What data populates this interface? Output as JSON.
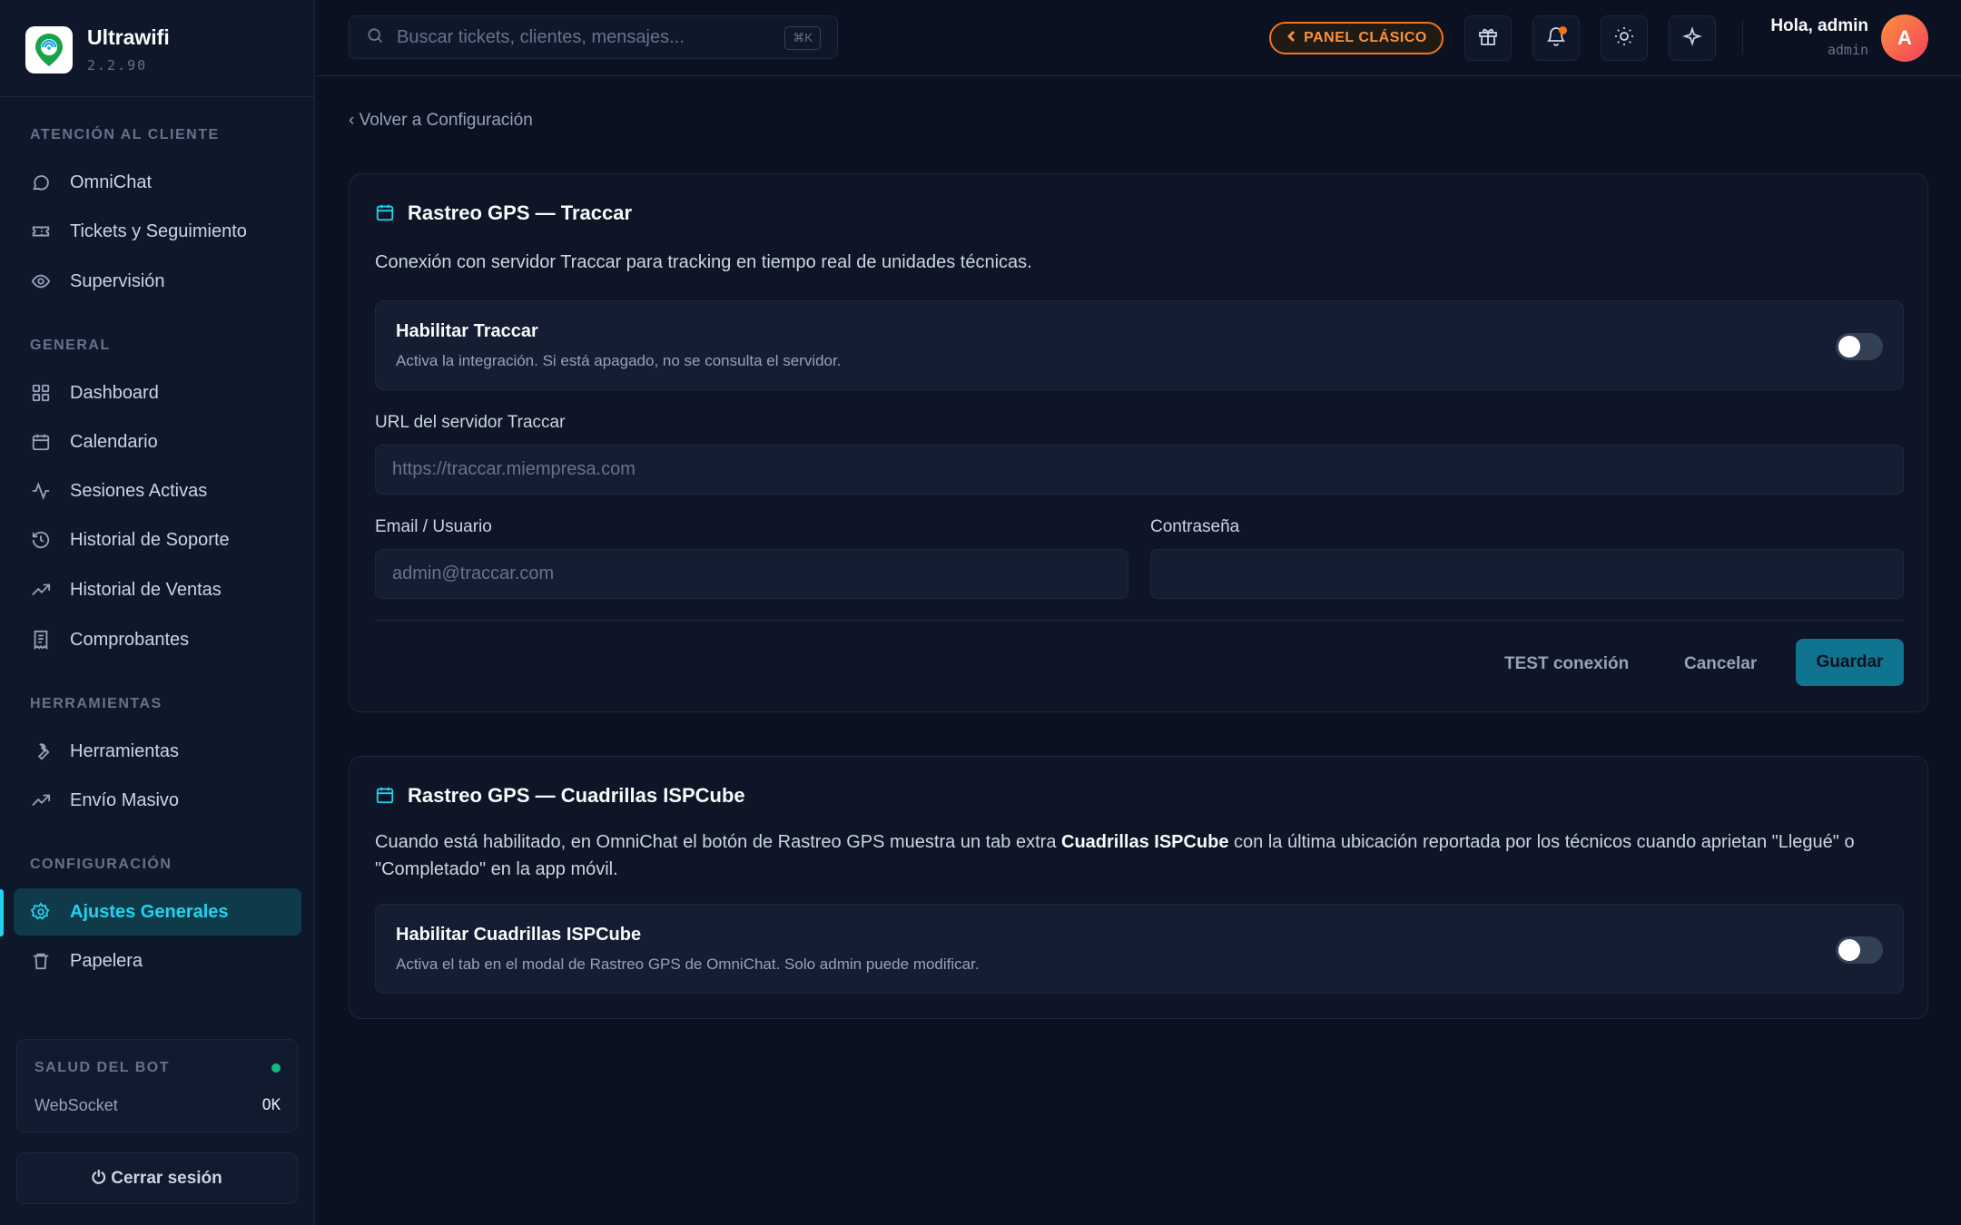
{
  "brand": {
    "name": "Ultrawifi",
    "version": "2.2.90"
  },
  "sidebar": {
    "sections": [
      {
        "title": "ATENCIÓN AL CLIENTE",
        "items": [
          "OmniChat",
          "Tickets y Seguimiento",
          "Supervisión"
        ]
      },
      {
        "title": "GENERAL",
        "items": [
          "Dashboard",
          "Calendario",
          "Sesiones Activas",
          "Historial de Soporte",
          "Historial de Ventas",
          "Comprobantes"
        ]
      },
      {
        "title": "HERRAMIENTAS",
        "items": [
          "Herramientas",
          "Envío Masivo"
        ]
      },
      {
        "title": "CONFIGURACIÓN",
        "items": [
          "Ajustes Generales",
          "Papelera"
        ]
      }
    ],
    "active_item": "Ajustes Generales",
    "bot_health": {
      "title": "SALUD DEL BOT",
      "label": "WebSocket",
      "value": "OK",
      "status_color": "#10b981"
    },
    "logout_label": "Cerrar sesión"
  },
  "header": {
    "search_placeholder": "Buscar tickets, clientes, mensajes...",
    "search_shortcut": "⌘K",
    "classic_panel_label": "PANEL CLÁSICO",
    "icons": [
      "gift-icon",
      "bell-icon",
      "sun-icon",
      "sparkle-icon"
    ],
    "greeting": "Hola, admin",
    "role": "admin",
    "avatar_initial": "A"
  },
  "main": {
    "back_link": "‹ Volver a Configuración",
    "traccar": {
      "title": "Rastreo GPS — Traccar",
      "description": "Conexión con servidor Traccar para tracking en tiempo real de unidades técnicas.",
      "toggle": {
        "title": "Habilitar Traccar",
        "subtitle": "Activa la integración. Si está apagado, no se consulta el servidor.",
        "enabled": false
      },
      "url_label": "URL del servidor Traccar",
      "url_placeholder": "https://traccar.miempresa.com",
      "email_label": "Email / Usuario",
      "email_placeholder": "admin@traccar.com",
      "password_label": "Contraseña",
      "test_label": "TEST conexión",
      "cancel_label": "Cancelar",
      "save_label": "Guardar"
    },
    "ispcube": {
      "title": "Rastreo GPS — Cuadrillas ISPCube",
      "description_pre": "Cuando está habilitado, en OmniChat el botón de Rastreo GPS muestra un tab extra ",
      "description_bold": "Cuadrillas ISPCube",
      "description_post": " con la última ubicación reportada por los técnicos cuando aprietan \"Llegué\" o \"Completado\" en la app móvil.",
      "toggle": {
        "title": "Habilitar Cuadrillas ISPCube",
        "subtitle": "Activa el tab en el modal de Rastreo GPS de OmniChat. Solo admin puede modificar.",
        "enabled": false
      }
    }
  },
  "colors": {
    "accent": "#22d3ee",
    "classic": "#f97316",
    "save": "#0e7490"
  }
}
